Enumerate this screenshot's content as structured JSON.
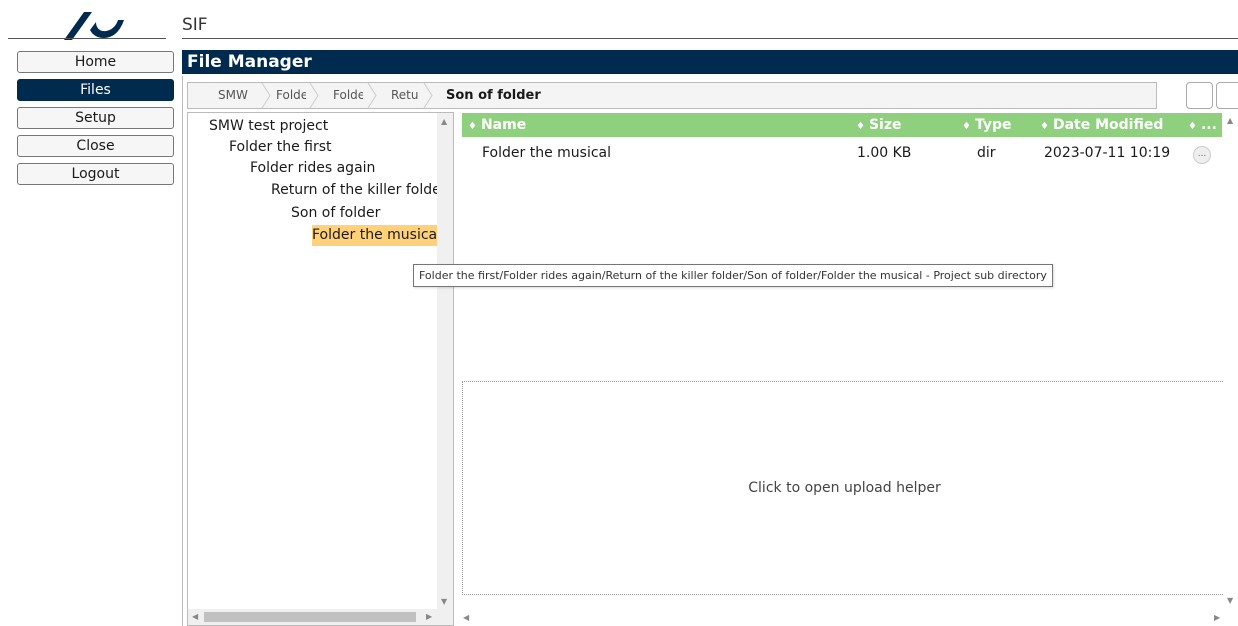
{
  "app": {
    "title": "SIF",
    "brand_color": "#002b4f"
  },
  "menu": {
    "items": [
      {
        "label": "Home",
        "active": false
      },
      {
        "label": "Files",
        "active": true
      },
      {
        "label": "Setup",
        "active": false
      },
      {
        "label": "Close",
        "active": false
      },
      {
        "label": "Logout",
        "active": false
      }
    ]
  },
  "file_manager": {
    "title": "File Manager",
    "breadcrumb": [
      {
        "label": "SMW"
      },
      {
        "label": "Folde"
      },
      {
        "label": "Folde"
      },
      {
        "label": "Retu"
      },
      {
        "label": "Son of folder",
        "current": true
      }
    ],
    "tree": [
      {
        "label": "SMW test project",
        "level": 0
      },
      {
        "label": "Folder the first",
        "level": 1
      },
      {
        "label": "Folder rides again",
        "level": 2
      },
      {
        "label": "Return of the killer folde",
        "level": 3
      },
      {
        "label": "Son of folder",
        "level": 4
      },
      {
        "label": "Folder the musical",
        "level": 5,
        "selected": true
      }
    ],
    "columns": {
      "name": "Name",
      "size": "Size",
      "type": "Type",
      "modified": "Date Modified",
      "extra": "..."
    },
    "sort_glyph": "♦",
    "files": [
      {
        "name": "Folder the musical",
        "size": "1.00 KB",
        "type": "dir",
        "modified": "2023-07-11 10:19",
        "more": "..."
      }
    ],
    "upload_text": "Click to open upload helper",
    "header_color": "#8ed07d",
    "selected_color": "#ffd27a"
  },
  "tooltip": {
    "text": "Folder the first/Folder rides again/Return of the killer folder/Son of folder/Folder the musical  - Project sub directory"
  }
}
